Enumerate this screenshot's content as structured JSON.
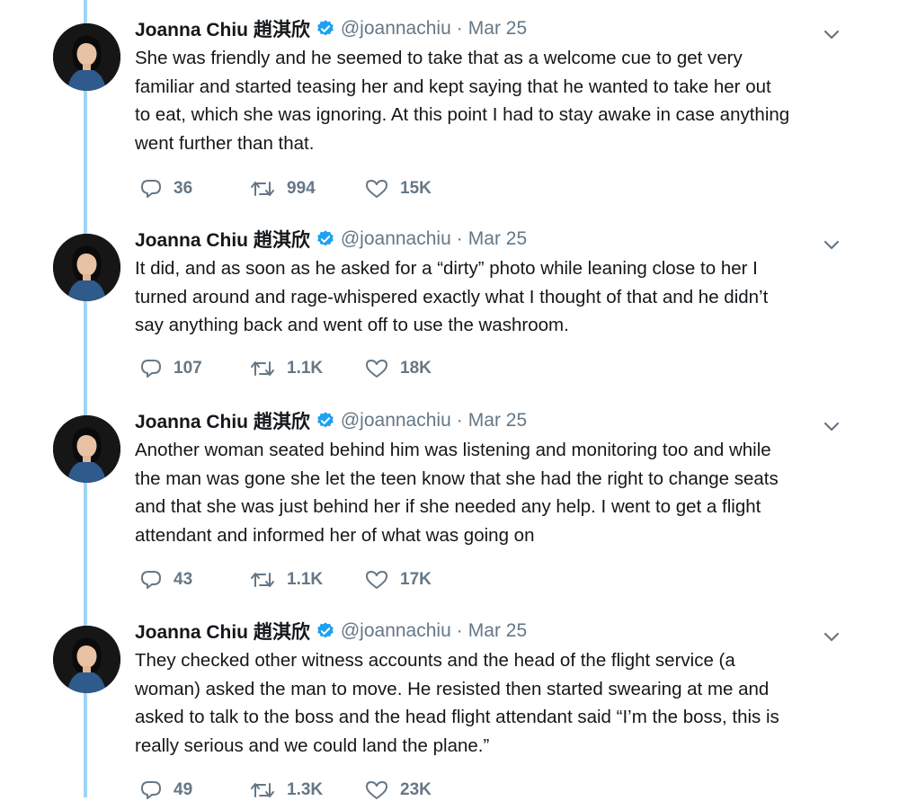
{
  "tweets": [
    {
      "author": "Joanna Chiu 趙淇欣",
      "handle": "@joannachiu",
      "separator": "·",
      "date": "Mar 25",
      "lines": [
        "She was friendly and he seemed to take that as a welcome cue to get very",
        "familiar and started teasing her and kept saying that he wanted to take her out",
        "to eat, which she was ignoring. At this point I had to stay awake in case anything",
        "went further than that."
      ],
      "replies": "36",
      "retweets": "994",
      "likes": "15K"
    },
    {
      "author": "Joanna Chiu 趙淇欣",
      "handle": "@joannachiu",
      "separator": "·",
      "date": "Mar 25",
      "lines": [
        "It did, and as soon as he asked for a “dirty” photo while leaning close to her I",
        "turned around and rage-whispered exactly what I thought of that and he didn’t",
        "say anything back and went off to use the washroom."
      ],
      "replies": "107",
      "retweets": "1.1K",
      "likes": "18K"
    },
    {
      "author": "Joanna Chiu 趙淇欣",
      "handle": "@joannachiu",
      "separator": "·",
      "date": "Mar 25",
      "lines": [
        "Another woman seated behind him was listening and monitoring too and while",
        "the man was gone she let the teen know that she had the right to change seats",
        "and that she was just behind her if she needed any help. I went to get a flight",
        "attendant and informed her of what was going on"
      ],
      "replies": "43",
      "retweets": "1.1K",
      "likes": "17K"
    },
    {
      "author": "Joanna Chiu 趙淇欣",
      "handle": "@joannachiu",
      "separator": "·",
      "date": "Mar 25",
      "lines": [
        "They checked other witness accounts and the head of the flight service (a",
        "woman) asked the man to move. He resisted then started swearing at me and",
        "asked to talk to the boss and the head flight attendant said “I’m the boss, this is",
        "really serious and we could land the plane.”"
      ],
      "replies": "49",
      "retweets": "1.3K",
      "likes": "23K"
    }
  ],
  "icons": {
    "verified": "verified-badge-icon",
    "menu": "chevron-down-icon",
    "reply": "reply-icon",
    "retweet": "retweet-icon",
    "like": "heart-icon"
  },
  "colors": {
    "thread_line": "#9fd4f5",
    "verified": "#1da1f2",
    "secondary_text": "#657786",
    "primary_text": "#14171a"
  }
}
